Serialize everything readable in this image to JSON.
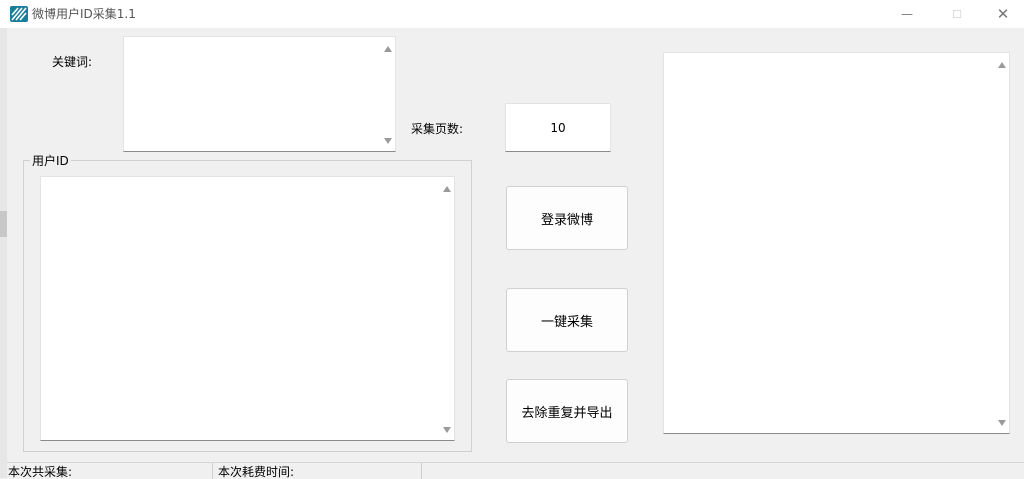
{
  "window": {
    "title": "微博用户ID采集1.1",
    "controls": {
      "minimize": "—",
      "maximize": "☐",
      "close": "✕"
    }
  },
  "keyword": {
    "label": "关键词:",
    "value": ""
  },
  "user_id": {
    "group_label": "用户ID",
    "value": ""
  },
  "pages": {
    "label": "采集页数:",
    "value": "10"
  },
  "buttons": {
    "login": "登录微博",
    "collect": "一键采集",
    "dedup_export": "去除重复并导出"
  },
  "output": {
    "value": ""
  },
  "statusbar": {
    "total_label": "本次共采集:",
    "time_label": "本次耗费时间:"
  },
  "colors": {
    "app_icon": "#1a7d9a",
    "background": "#f0f0f0"
  }
}
